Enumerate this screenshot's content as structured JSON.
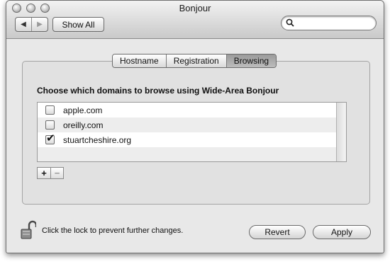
{
  "window": {
    "title": "Bonjour"
  },
  "toolbar": {
    "back_glyph": "◀",
    "forward_glyph": "▶",
    "show_all_label": "Show All",
    "search_value": "",
    "search_placeholder": ""
  },
  "tabs": [
    {
      "label": "Hostname",
      "active": false
    },
    {
      "label": "Registration",
      "active": false
    },
    {
      "label": "Browsing",
      "active": true
    }
  ],
  "browsing": {
    "heading": "Choose which domains to browse using Wide-Area Bonjour",
    "domains": [
      {
        "label": "apple.com",
        "checked": false
      },
      {
        "label": "oreilly.com",
        "checked": false
      },
      {
        "label": "stuartcheshire.org",
        "checked": true
      }
    ],
    "add_glyph": "+",
    "remove_glyph": "−"
  },
  "footer": {
    "lock_text": "Click the lock to prevent further changes.",
    "revert_label": "Revert",
    "apply_label": "Apply"
  },
  "colors": {
    "window_bg": "#e8e8e8",
    "active_tab": "#9a9a9a",
    "alt_row": "#ededed"
  },
  "icons": {
    "lock": "lock-open-icon",
    "search": "search-icon",
    "checkmark": "checkmark-icon"
  }
}
